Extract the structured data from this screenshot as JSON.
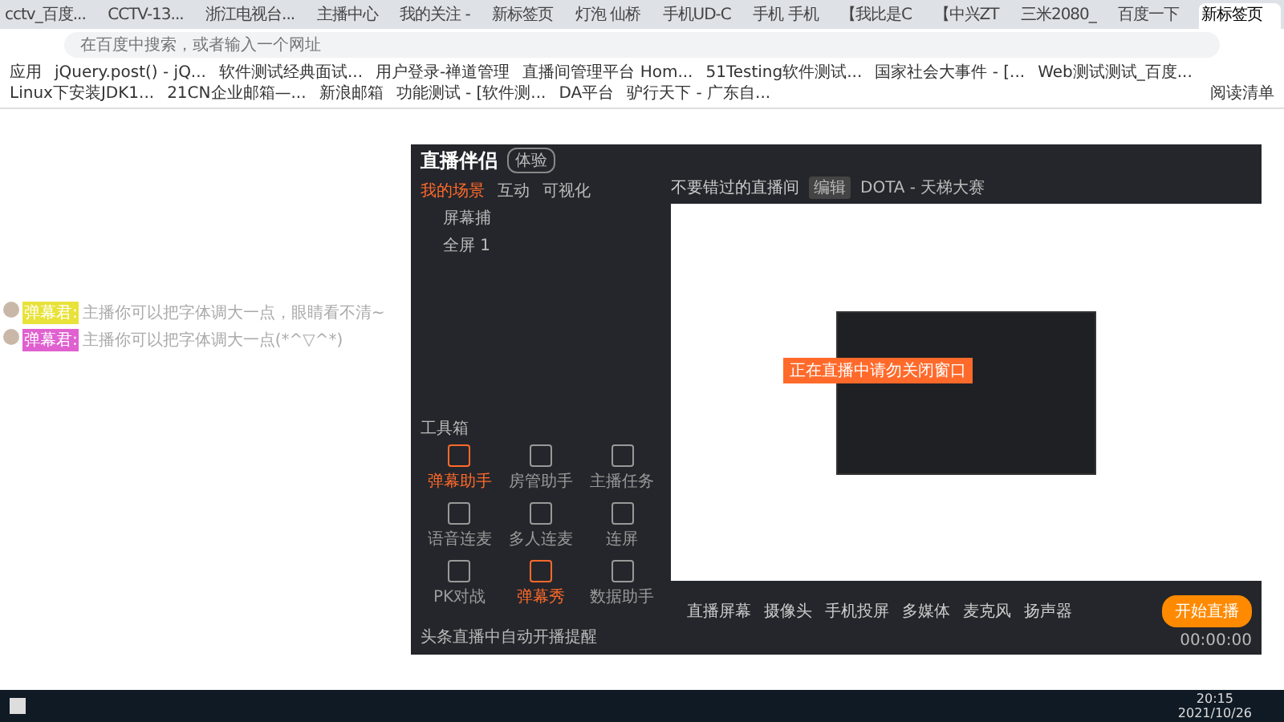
{
  "browser": {
    "tabs": [
      {
        "title": "cctv_百度...",
        "selected": false
      },
      {
        "title": "CCTV-13...",
        "selected": false
      },
      {
        "title": "浙江电视台...",
        "selected": false
      },
      {
        "title": "主播中心",
        "selected": false
      },
      {
        "title": "我的关注 -",
        "selected": false
      },
      {
        "title": "新标签页",
        "selected": false
      },
      {
        "title": "灯泡 仙桥",
        "selected": false
      },
      {
        "title": "手机UD-C",
        "selected": false
      },
      {
        "title": "手机 手机",
        "selected": false
      },
      {
        "title": "【我比是C",
        "selected": false
      },
      {
        "title": "【中兴ZT",
        "selected": false
      },
      {
        "title": "三米2080_",
        "selected": false
      },
      {
        "title": "百度一下",
        "selected": false
      },
      {
        "title": "新标签页",
        "selected": true
      }
    ],
    "address": {
      "placeholder": "在百度中搜索，或者输入一个网址"
    },
    "bookmarks": [
      "应用",
      "jQuery.post() - jQ...",
      "软件测试经典面试...",
      "用户登录-禅道管理",
      "直播间管理平台 Hom...",
      "51Testing软件测试...",
      "国家社会大事件 - [...",
      "Web测试测试_百度...",
      "Linux下安装JDK1...",
      "21CN企业邮箱—...",
      "新浪邮箱",
      "功能测试 - [软件测...",
      "DA平台",
      "驴行天下 - 广东自..."
    ],
    "reading_list": "阅读清单"
  },
  "chat": [
    {
      "user": "弹幕君:",
      "color": "#e8e23a",
      "text": "主播你可以把字体调大一点，眼睛看不清~"
    },
    {
      "user": "弹幕君:",
      "color": "#e060d0",
      "text": "主播你可以把字体调大一点(*^▽^*)"
    }
  ],
  "app": {
    "title": "直播伴侣",
    "badge": "体验",
    "scene_tabs": [
      {
        "label": "我的场景",
        "selected": true
      },
      {
        "label": "互动",
        "selected": false
      },
      {
        "label": "可视化",
        "selected": false
      }
    ],
    "sources": [
      "屏幕捕",
      "全屏 1"
    ],
    "room_title": "不要错过的直播间",
    "room_tag": "编辑",
    "room_id": "DOTA - 天梯大赛",
    "toolbox": "工具箱",
    "tools": [
      {
        "label": "弹幕助手",
        "active": true
      },
      {
        "label": "房管助手",
        "active": false
      },
      {
        "label": "主播任务",
        "active": false
      },
      {
        "label": "语音连麦",
        "active": false
      },
      {
        "label": "多人连麦",
        "active": false
      },
      {
        "label": "连屏",
        "active": false
      },
      {
        "label": "PK对战",
        "active": false
      },
      {
        "label": "弹幕秀",
        "active": true
      },
      {
        "label": "数据助手",
        "active": false
      }
    ],
    "notice": "头条直播中自动开播提醒",
    "preview_label": "正在直播中请勿关闭窗口",
    "controls": [
      "直播屏幕",
      "摄像头",
      "手机投屏",
      "多媒体",
      "麦克风",
      "扬声器"
    ],
    "start": "开始直播",
    "timer": "00:00:00"
  },
  "taskbar": {
    "time": "20:15",
    "date": "2021/10/26"
  }
}
